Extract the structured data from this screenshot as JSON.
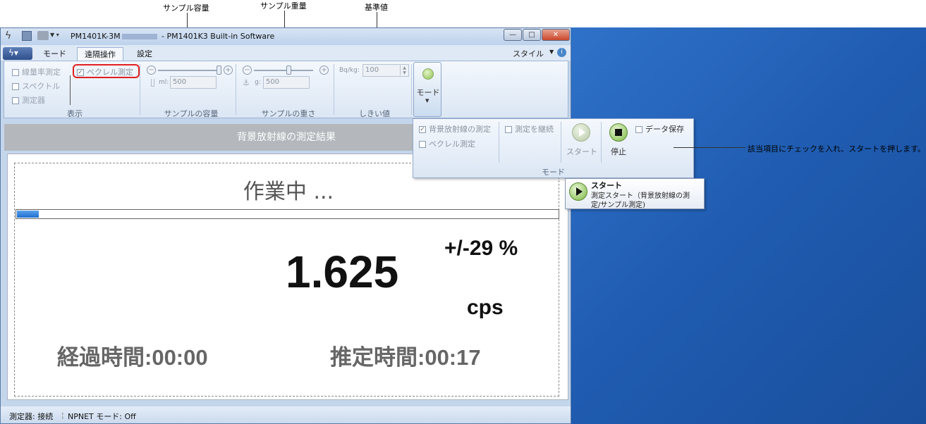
{
  "annotations": {
    "sample_volume": "サンプル容量",
    "sample_weight": "サンプル重量",
    "reference_value": "基準値",
    "instruction": "該当項目にチェックを入れ、スタートを押します。"
  },
  "window": {
    "title_left": "PM1401K-3M",
    "title_right": "- PM1401K3 Built-in Software",
    "min": "—",
    "max": "□",
    "close": "✕"
  },
  "tabs": [
    "モード",
    "遠隔操作",
    "設定"
  ],
  "style_menu": "スタイル",
  "ribbon": {
    "display": {
      "items": [
        "線量率測定",
        "スペクトル",
        "測定器"
      ],
      "becquerel": "ベクレル測定",
      "label": "表示"
    },
    "volume": {
      "unit": "ml:",
      "value": "500",
      "label": "サンプルの容量"
    },
    "weight": {
      "unit": "g:",
      "value": "500",
      "label": "サンプルの重さ"
    },
    "threshold": {
      "unit": "Bq/kg:",
      "value": "100",
      "label": "しきい値"
    },
    "mode_button": "モード"
  },
  "mode_panel": {
    "bg_measure": "背景放射線の測定",
    "becquerel": "ベクレル測定",
    "continue": "測定を継続",
    "start": "スタート",
    "stop": "停止",
    "save": "データ保存",
    "label": "モード"
  },
  "tooltip": {
    "title": "スタート",
    "line1": "測定スタート（背景放射線の測",
    "line2": "定/サンプル測定)"
  },
  "results": {
    "header": "背景放射線の測定結果",
    "status": "作業中 ...",
    "progress": 0.04,
    "value": "1.625",
    "error": "+/-29 %",
    "unit": "cps",
    "elapsed": "経過時間:00:00",
    "estimated": "推定時間:00:17"
  },
  "statusbar": {
    "device": "測定器: 接続",
    "npnet": "NPNET モード: Off"
  }
}
